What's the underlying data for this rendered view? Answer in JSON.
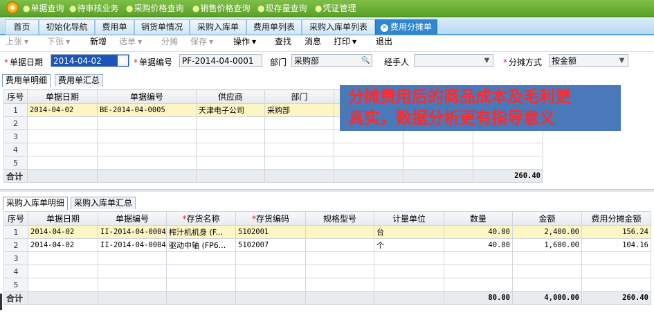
{
  "top_nav": [
    "单据查询",
    "待审核业务",
    "采购价格查询",
    "销售价格查询",
    "现存量查询",
    "凭证管理"
  ],
  "tabs": [
    "首页",
    "初始化导航",
    "费用单",
    "销货单情况",
    "采购入库单",
    "费用单列表",
    "采购入库单列表",
    "费用分摊单"
  ],
  "active_tab": "费用分摊单",
  "toolbar": {
    "prev": "上张",
    "next": "下张",
    "new": "新增",
    "select": "选单",
    "allocate": "分摊",
    "save": "保存",
    "operate": "操作",
    "find": "查找",
    "message": "消息",
    "print": "打印",
    "exit": "退出"
  },
  "form": {
    "date_label": "单据日期",
    "date_value": "2014-04-02",
    "number_label": "单据编号",
    "number_value": "PF-2014-04-0001",
    "dept_label": "部门",
    "dept_value": "采购部",
    "handler_label": "经手人",
    "handler_value": "",
    "method_label": "分摊方式",
    "method_value": "按金额"
  },
  "fee_subtabs": [
    "费用单明细",
    "费用单汇总"
  ],
  "fee_grid": {
    "headers": [
      "序号",
      "单据日期",
      "单据编号",
      "供应商",
      "部门"
    ],
    "rows": [
      {
        "idx": "1",
        "date": "2014-04-02",
        "number": "BE-2014-04-0005",
        "supplier": "天津电子公司",
        "dept": "采购部"
      },
      {
        "idx": "2"
      },
      {
        "idx": "3"
      },
      {
        "idx": "4"
      },
      {
        "idx": "5"
      }
    ],
    "total_label": "合计",
    "total_amount": "260.40"
  },
  "callout": {
    "line1": "分摊费用后的商品成本及毛利更",
    "line2": "真实，数据分析更有指导意义"
  },
  "purchase_subtabs": [
    "采购入库单明细",
    "采购入库单汇总"
  ],
  "purchase_grid": {
    "headers": [
      "序号",
      "单据日期",
      "单据编号",
      "存货名称",
      "存货编码",
      "规格型号",
      "计量单位",
      "数量",
      "金额",
      "费用分摊金额"
    ],
    "rows": [
      {
        "idx": "1",
        "date": "2014-04-02",
        "number": "II-2014-04-0004",
        "name": "榨汁机机身 (F...",
        "code": "5102001",
        "spec": "",
        "unit": "台",
        "qty": "40.00",
        "amount": "2,400.00",
        "alloc": "156.24"
      },
      {
        "idx": "2",
        "date": "2014-04-02",
        "number": "II-2014-04-0004",
        "name": "驱动中轴 (FP6...",
        "code": "5102007",
        "spec": "",
        "unit": "个",
        "qty": "40.00",
        "amount": "1,600.00",
        "alloc": "104.16"
      },
      {
        "idx": "3"
      },
      {
        "idx": "4"
      },
      {
        "idx": "5"
      }
    ],
    "total_label": "合计",
    "total_qty": "80.00",
    "total_amount": "4,000.00",
    "total_alloc": "260.40"
  },
  "colors": {
    "nav_green": "#5aa028",
    "active_tab": "#2f87cf",
    "callout_bg": "#4a79ba",
    "callout_text": "#ff2a2a",
    "row_highlight": "#fdf6c4"
  }
}
